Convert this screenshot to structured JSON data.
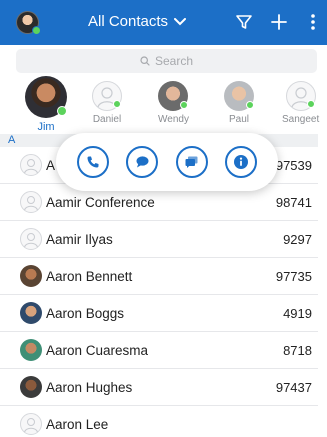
{
  "header": {
    "title": "All Contacts",
    "title_chevron_icon": "chevron-down-icon",
    "filter_icon": "filter-icon",
    "add_icon": "plus-icon",
    "more_icon": "more-vertical-icon",
    "accent_color": "#1c6fc7"
  },
  "search": {
    "placeholder": "Search"
  },
  "favorites": [
    {
      "name": "Jim",
      "selected": true,
      "status": "online"
    },
    {
      "name": "Daniel",
      "selected": false,
      "status": "online"
    },
    {
      "name": "Wendy",
      "selected": false,
      "status": "online"
    },
    {
      "name": "Paul",
      "selected": false,
      "status": "online"
    },
    {
      "name": "Sangeet",
      "selected": false,
      "status": "online"
    }
  ],
  "section": {
    "letter": "A"
  },
  "contacts": [
    {
      "name": "A Z",
      "ext": "97539",
      "avatar": "placeholder"
    },
    {
      "name": "Aamir Conference",
      "ext": "98741",
      "avatar": "placeholder"
    },
    {
      "name": "Aamir Ilyas",
      "ext": "9297",
      "avatar": "placeholder"
    },
    {
      "name": "Aaron Bennett",
      "ext": "97735",
      "avatar": "photo"
    },
    {
      "name": "Aaron Boggs",
      "ext": "4919",
      "avatar": "photo"
    },
    {
      "name": "Aaron Cuaresma",
      "ext": "8718",
      "avatar": "photo"
    },
    {
      "name": "Aaron Hughes",
      "ext": "97437",
      "avatar": "photo"
    },
    {
      "name": "Aaron Lee",
      "ext": "",
      "avatar": "placeholder"
    }
  ],
  "quick_actions": [
    {
      "name": "call",
      "icon": "phone-icon"
    },
    {
      "name": "chat",
      "icon": "chat-bubble-icon"
    },
    {
      "name": "message",
      "icon": "messages-icon"
    },
    {
      "name": "info",
      "icon": "info-icon"
    }
  ]
}
